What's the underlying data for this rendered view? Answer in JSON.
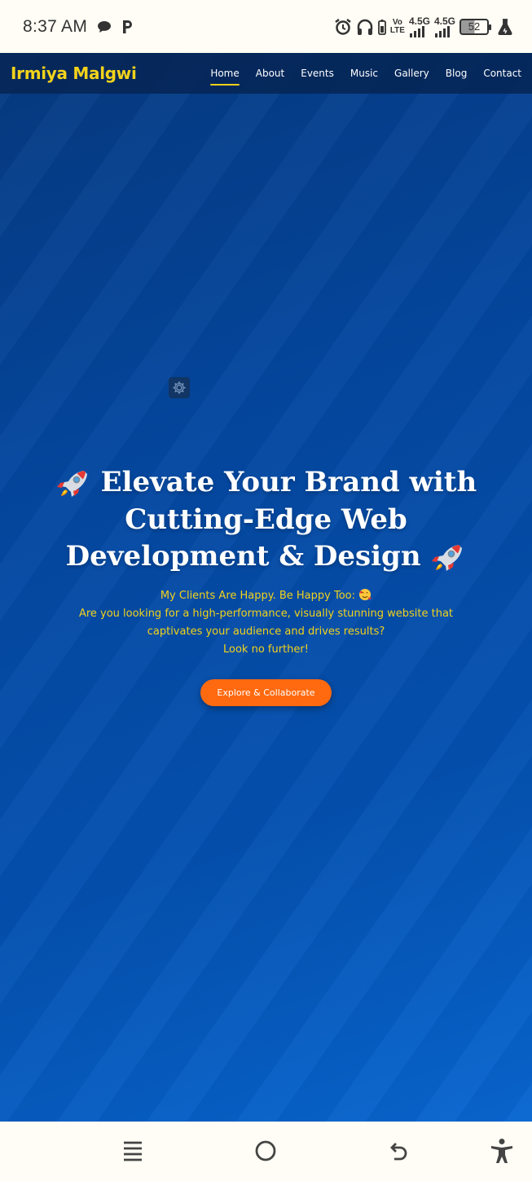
{
  "status_bar": {
    "time": "8:37 AM",
    "left_icons": [
      "message-bubble-icon",
      "p-notification-icon"
    ],
    "right_icons": [
      "alarm-icon",
      "headphones-icon",
      "battery-saver-icon",
      "volte-icon",
      "signal-icon",
      "signal-icon",
      "battery-icon",
      "lab-flask-icon"
    ],
    "volte_top": "Vo",
    "volte_bottom": "LTE",
    "network_1": "4.5G",
    "network_2": "4.5G",
    "battery_level": "52"
  },
  "site": {
    "brand": "Irmiya Malgwi",
    "nav": {
      "home": "Home",
      "about": "About",
      "events": "Events",
      "music": "Music",
      "gallery": "Gallery",
      "blog": "Blog",
      "contact": "Contact"
    },
    "active_nav": "Home",
    "hero": {
      "title_line_1": "Elevate Your Brand with",
      "title_line_2": "Cutting-Edge Web",
      "title_line_3": "Development & Design",
      "sub_line_1": "My Clients Are Happy. Be Happy Too:",
      "sub_line_2": "Are you looking for a high-performance, visually stunning website that",
      "sub_line_3": "captivates your audience and drives results?",
      "sub_line_4": "Look no further!",
      "cta": "Explore & Collaborate"
    },
    "colors": {
      "brand_yellow": "#f2d21b",
      "cta_orange": "#ff6a10",
      "hero_blue": "#0447a0"
    }
  },
  "system_nav": [
    "recents-icon",
    "home-icon",
    "back-icon",
    "accessibility-icon"
  ]
}
